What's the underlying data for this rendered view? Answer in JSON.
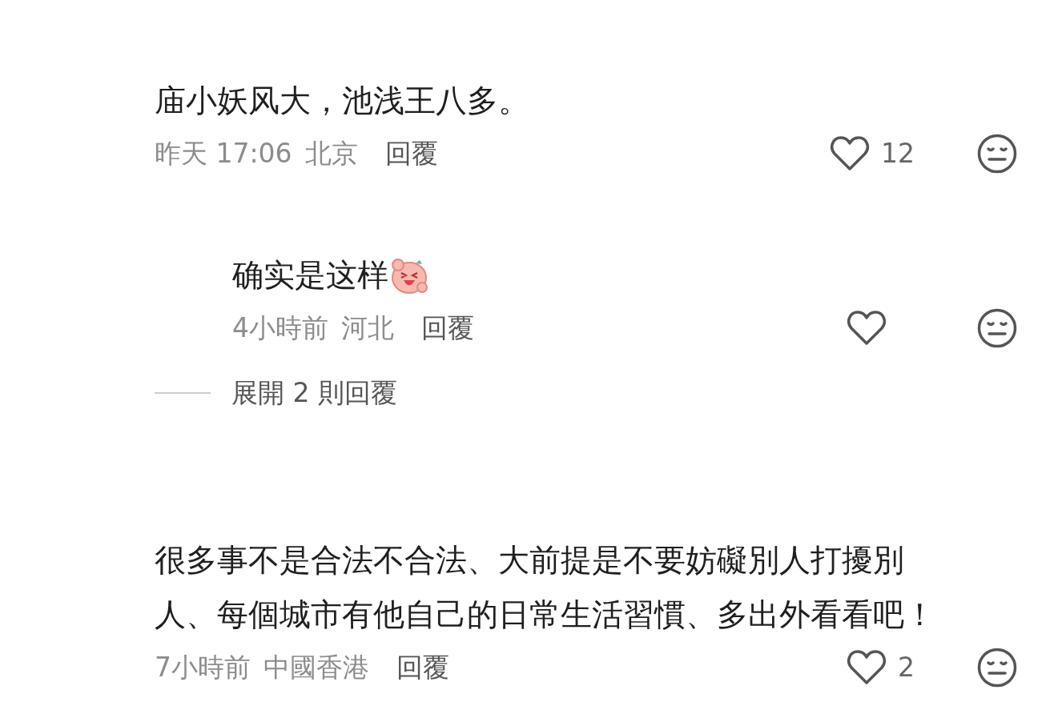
{
  "comments": [
    {
      "text": "庙小妖风大，池浅王八多。",
      "sticker": false,
      "time": "昨天 17:06",
      "location": "北京",
      "reply_label": "回覆",
      "likes": "12",
      "liked": false,
      "replies": [
        {
          "text": "确实是这样",
          "sticker": true,
          "time": "4小時前",
          "location": "河北",
          "reply_label": "回覆",
          "liked": false
        }
      ],
      "expand_label": "展開 2 則回覆"
    },
    {
      "text": "很多事不是合法不合法、大前提是不要妨礙別人打擾別人、每個城市有他自己的日常生活習慣、多出外看看吧！",
      "sticker": false,
      "time": "7小時前",
      "location": "中國香港",
      "reply_label": "回覆",
      "likes": "2",
      "liked": false
    }
  ]
}
